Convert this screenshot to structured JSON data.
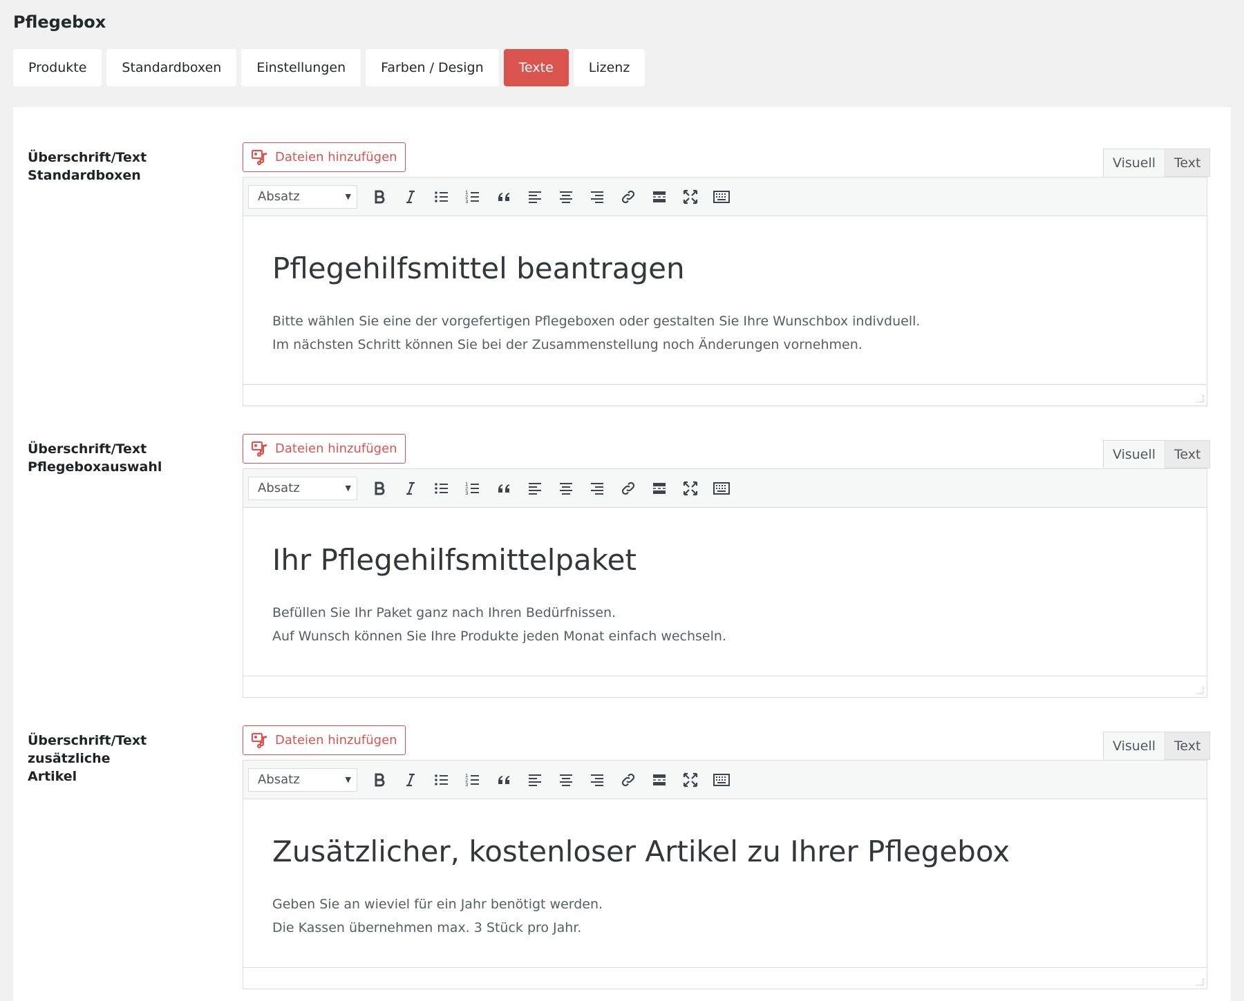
{
  "page": {
    "title": "Pflegebox"
  },
  "tabs": [
    {
      "label": "Produkte",
      "active": false
    },
    {
      "label": "Standardboxen",
      "active": false
    },
    {
      "label": "Einstellungen",
      "active": false
    },
    {
      "label": "Farben / Design",
      "active": false
    },
    {
      "label": "Texte",
      "active": true
    },
    {
      "label": "Lizenz",
      "active": false
    }
  ],
  "colors": {
    "accent": "#d9534f",
    "background": "#f1f1f1",
    "panel": "#ffffff"
  },
  "editor_common": {
    "media_button_label": "Dateien hinzufügen",
    "mode_visual": "Visuell",
    "mode_text": "Text",
    "format_select": "Absatz",
    "toolbar_icons": [
      "bold-icon",
      "italic-icon",
      "bulleted-list-icon",
      "numbered-list-icon",
      "blockquote-icon",
      "align-left-icon",
      "align-center-icon",
      "align-right-icon",
      "link-icon",
      "read-more-icon",
      "fullscreen-icon",
      "toolbar-toggle-icon"
    ]
  },
  "rows": [
    {
      "label_line1": "Überschrift/Text",
      "label_line2": "Standardboxen",
      "heading": "Pflegehilfsmittel beantragen",
      "line1": "Bitte wählen Sie eine der vorgefertigen Pflegeboxen oder gestalten Sie Ihre Wunschbox indivduell.",
      "line2": "Im nächsten Schritt können Sie bei der Zusammenstellung noch Änderungen vornehmen."
    },
    {
      "label_line1": "Überschrift/Text",
      "label_line2": "Pflegeboxauswahl",
      "heading": "Ihr Pflegehilfsmittelpaket",
      "line1": "Befüllen Sie Ihr Paket ganz nach Ihren Bedürfnissen.",
      "line2": "Auf Wunsch können Sie Ihre Produkte jeden Monat einfach wechseln."
    },
    {
      "label_line1": "Überschrift/Text zusätzliche",
      "label_line2": "Artikel",
      "heading": "Zusätzlicher, kostenloser Artikel zu Ihrer Pflegebox",
      "line1": "Geben Sie an wieviel für ein Jahr benötigt werden.",
      "line2": "Die Kassen übernehmen max. 3 Stück pro Jahr."
    }
  ]
}
